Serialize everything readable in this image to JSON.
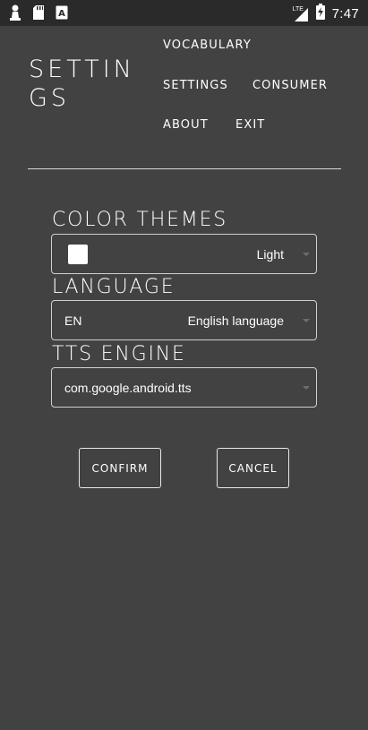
{
  "status_bar": {
    "time": "7:47",
    "network": "LTE",
    "icons": [
      "pawn-icon",
      "sd-card-icon",
      "a-letter-icon",
      "signal-icon",
      "battery-charging-icon"
    ]
  },
  "header": {
    "title": "SETTINGS",
    "nav": {
      "vocabulary": "VOCABULARY",
      "settings": "SETTINGS",
      "consumer": "CONSUMER",
      "about": "ABOUT",
      "exit": "EXIT"
    }
  },
  "color_themes": {
    "label": "COLOR THEMES",
    "selected": "Light",
    "swatch_color": "#ffffff"
  },
  "language": {
    "label": "LANGUAGE",
    "code": "EN",
    "name": "English language"
  },
  "tts_engine": {
    "label": "TTS ENGINE",
    "selected": "com.google.android.tts"
  },
  "buttons": {
    "confirm": "CONFIRM",
    "cancel": "CANCEL"
  },
  "colors": {
    "background": "#424242",
    "status_bar": "#2a2a2a",
    "text": "#ffffff"
  }
}
